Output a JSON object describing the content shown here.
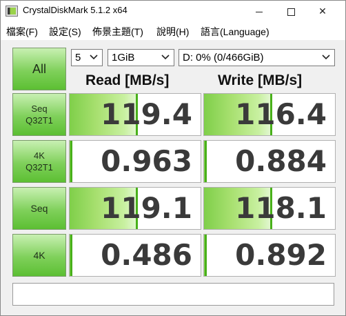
{
  "window": {
    "title": "CrystalDiskMark 5.1.2 x64",
    "minimize_label": "minimize",
    "maximize_label": "maximize",
    "close_glyph": "✕"
  },
  "menu": [
    {
      "label": "檔案(F)"
    },
    {
      "label": "設定(S)"
    },
    {
      "label": "佈景主題(T)"
    },
    {
      "label": "說明(H)"
    },
    {
      "label": "語言(Language)"
    }
  ],
  "controls": {
    "all_label": "All",
    "count_value": "5",
    "size_value": "1GiB",
    "drive_value": "D: 0% (0/466GiB)"
  },
  "headers": {
    "read": "Read [MB/s]",
    "write": "Write [MB/s]"
  },
  "tests": [
    {
      "label": "Seq\nQ32T1",
      "read": "119.4",
      "write": "116.4",
      "read_fill": 0.52,
      "write_fill": 0.52
    },
    {
      "label": "4K\nQ32T1",
      "read": "0.963",
      "write": "0.884",
      "read_fill": 0.02,
      "write_fill": 0.02
    },
    {
      "label": "Seq",
      "read": "119.1",
      "write": "118.1",
      "read_fill": 0.52,
      "write_fill": 0.52
    },
    {
      "label": "4K",
      "read": "0.486",
      "write": "0.892",
      "read_fill": 0.02,
      "write_fill": 0.02
    }
  ],
  "comment": ""
}
